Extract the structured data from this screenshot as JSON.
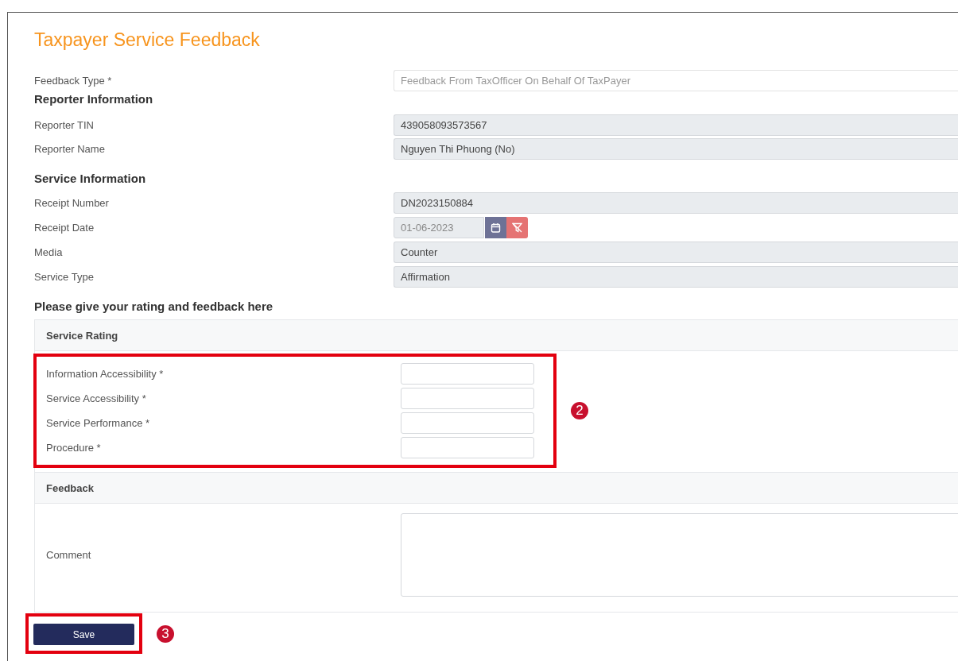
{
  "title": "Taxpayer Service Feedback",
  "feedback_type": {
    "label": "Feedback Type *",
    "value": "Feedback From TaxOfficer On Behalf Of TaxPayer"
  },
  "sections": [
    {
      "heading": "Reporter Information",
      "fields": [
        {
          "kind": "text",
          "label": "Reporter TIN",
          "value": "439058093573567"
        },
        {
          "kind": "text",
          "label": "Reporter Name",
          "value": "Nguyen Thi Phuong (No)"
        }
      ]
    },
    {
      "heading": "Service Information",
      "fields": [
        {
          "kind": "text",
          "label": "Receipt Number",
          "value": "DN2023150884"
        },
        {
          "kind": "date",
          "label": "Receipt Date",
          "value": "01-06-2023"
        },
        {
          "kind": "text",
          "label": "Media",
          "value": "Counter"
        },
        {
          "kind": "text",
          "label": "Service Type",
          "value": "Affirmation"
        }
      ]
    }
  ],
  "rating_heading": "Please give your rating and feedback here",
  "service_rating": {
    "title": "Service Rating",
    "callout": "2",
    "items": [
      {
        "label": "Information Accessibility *"
      },
      {
        "label": "Service Accessibility *"
      },
      {
        "label": "Service Performance *"
      },
      {
        "label": "Procedure *"
      }
    ]
  },
  "feedback": {
    "title": "Feedback",
    "comment_label": "Comment"
  },
  "save_button": {
    "label": "Save",
    "callout": "3"
  }
}
